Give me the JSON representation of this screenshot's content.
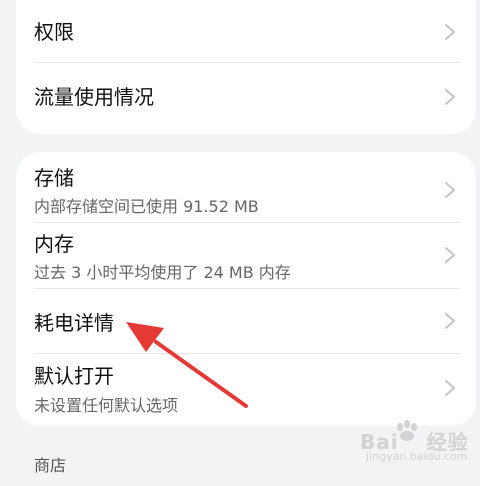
{
  "settings": {
    "top_group": [
      {
        "title": "权限"
      },
      {
        "title": "流量使用情况"
      }
    ],
    "main_group": [
      {
        "title": "存储",
        "subtitle": "内部存储空间已使用 91.52 MB"
      },
      {
        "title": "内存",
        "subtitle": "过去 3 小时平均使用了 24 MB 内存"
      },
      {
        "title": "耗电详情"
      },
      {
        "title": "默认打开",
        "subtitle": "未设置任何默认选项"
      }
    ],
    "section_label": "商店"
  },
  "icons": {
    "chevron": "chevron-right-icon",
    "annotation_arrow": "red-arrow-icon"
  },
  "colors": {
    "background": "#f1f3f5",
    "card": "#ffffff",
    "annotation": "#e53935",
    "chevron": "#c4c4c4"
  },
  "watermark": {
    "brand": "Bai",
    "chinese": "经验",
    "sub": "jingyan.baidu.com"
  }
}
